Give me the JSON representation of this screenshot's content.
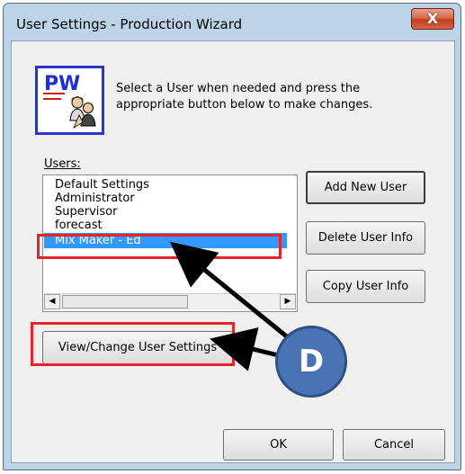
{
  "window": {
    "title": "User Settings - Production Wizard",
    "close_glyph": "X"
  },
  "logo": {
    "icon": "pw-users-logo",
    "text": "PW"
  },
  "instructions": "Select a User when needed and press the appropriate button below to make changes.",
  "users": {
    "label": "Users:",
    "items": [
      "Default Settings",
      "Administrator",
      "Supervisor",
      "forecast",
      "Mix Maker - Ed"
    ],
    "selected": "Mix Maker - Ed"
  },
  "buttons": {
    "add_new_user": "Add New User",
    "delete_user_info": "Delete User Info",
    "copy_user_info": "Copy User Info",
    "view_change_settings": "View/Change User Settings",
    "ok": "OK",
    "cancel": "Cancel"
  },
  "annotation": {
    "badge_text": "D",
    "highlight_color": "#e8232a",
    "badge_color": "#4a73b5"
  }
}
